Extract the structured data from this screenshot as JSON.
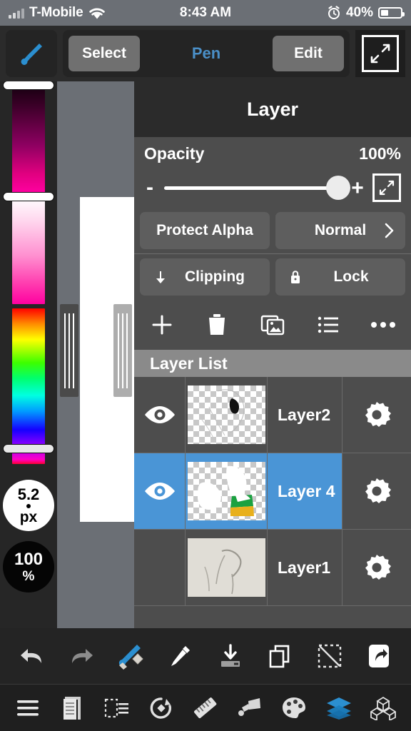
{
  "status_bar": {
    "carrier": "T-Mobile",
    "time": "8:43 AM",
    "battery_percent": "40%",
    "signal_icon": "signal-bars-icon",
    "wifi_icon": "wifi-icon",
    "alarm_icon": "alarm-clock-icon",
    "battery_icon": "battery-icon",
    "battery_level": 40
  },
  "toolbar": {
    "brush_icon": "paintbrush-icon",
    "select_label": "Select",
    "tool_title": "Pen",
    "edit_label": "Edit",
    "expand_icon": "expand-arrows-icon",
    "accent_color": "#4a8fc7"
  },
  "color_panel": {
    "brightness_slider": "brightness-slider",
    "saturation_slider": "saturation-slider",
    "hue_slider": "hue-slider",
    "brush_size_value": "5.2",
    "brush_size_unit": "px",
    "opacity_value": "100",
    "opacity_unit": "%"
  },
  "canvas": {
    "left_grip": "canvas-grip-left",
    "right_grip": "canvas-grip-right"
  },
  "layer_panel": {
    "title": "Layer",
    "opacity_label": "Opacity",
    "opacity_value": "100%",
    "opacity_slider_percent": 100,
    "minus_label": "-",
    "plus_label": "+",
    "expand_icon": "expand-arrows-icon",
    "protect_alpha_label": "Protect Alpha",
    "blend_mode_label": "Normal",
    "blend_chevron": "chevron-right-icon",
    "clipping_label": "Clipping",
    "clipping_icon": "clipping-arrow-icon",
    "lock_label": "Lock",
    "lock_icon": "padlock-icon",
    "actions": [
      {
        "name": "add-layer-button",
        "icon": "plus-icon"
      },
      {
        "name": "delete-layer-button",
        "icon": "trash-icon"
      },
      {
        "name": "import-image-button",
        "icon": "image-stack-icon"
      },
      {
        "name": "layer-list-button",
        "icon": "list-icon"
      },
      {
        "name": "more-options-button",
        "icon": "ellipsis-icon"
      }
    ],
    "list_header": "Layer List",
    "selected_color": "#4a95d6",
    "layers": [
      {
        "name": "Layer2",
        "visible": true,
        "selected": false,
        "thumbnail": "transparent-sketch-with-black-crescent"
      },
      {
        "name": "Layer 4",
        "visible": true,
        "selected": true,
        "thumbnail": "transparent-white-green-yellow-art"
      },
      {
        "name": "Layer1",
        "visible": false,
        "selected": false,
        "thumbnail": "photo-of-pencil-sketch-on-paper"
      }
    ]
  },
  "bottom_tools": [
    {
      "name": "undo-button",
      "icon": "undo-arrow-icon"
    },
    {
      "name": "redo-button",
      "icon": "redo-arrow-icon"
    },
    {
      "name": "brush-eraser-toggle",
      "icon": "brush-eraser-icon"
    },
    {
      "name": "eyedropper-button",
      "icon": "eyedropper-icon"
    },
    {
      "name": "import-button",
      "icon": "download-arrow-icon"
    },
    {
      "name": "duplicate-button",
      "icon": "copy-pages-icon"
    },
    {
      "name": "deselect-button",
      "icon": "deselect-icon"
    },
    {
      "name": "share-button",
      "icon": "share-arrow-icon"
    }
  ],
  "nav_bar": [
    {
      "name": "nav-menu",
      "icon": "hamburger-menu-icon",
      "active": false
    },
    {
      "name": "nav-document",
      "icon": "document-icon",
      "active": false
    },
    {
      "name": "nav-selection",
      "icon": "selection-icon",
      "active": false
    },
    {
      "name": "nav-transform",
      "icon": "rotate-icon",
      "active": false
    },
    {
      "name": "nav-ruler",
      "icon": "ruler-icon",
      "active": false
    },
    {
      "name": "nav-fill",
      "icon": "paint-bucket-icon",
      "active": false
    },
    {
      "name": "nav-palette",
      "icon": "palette-icon",
      "active": false
    },
    {
      "name": "nav-layers",
      "icon": "layers-icon",
      "active": true
    },
    {
      "name": "nav-3d",
      "icon": "cubes-icon",
      "active": false
    }
  ]
}
